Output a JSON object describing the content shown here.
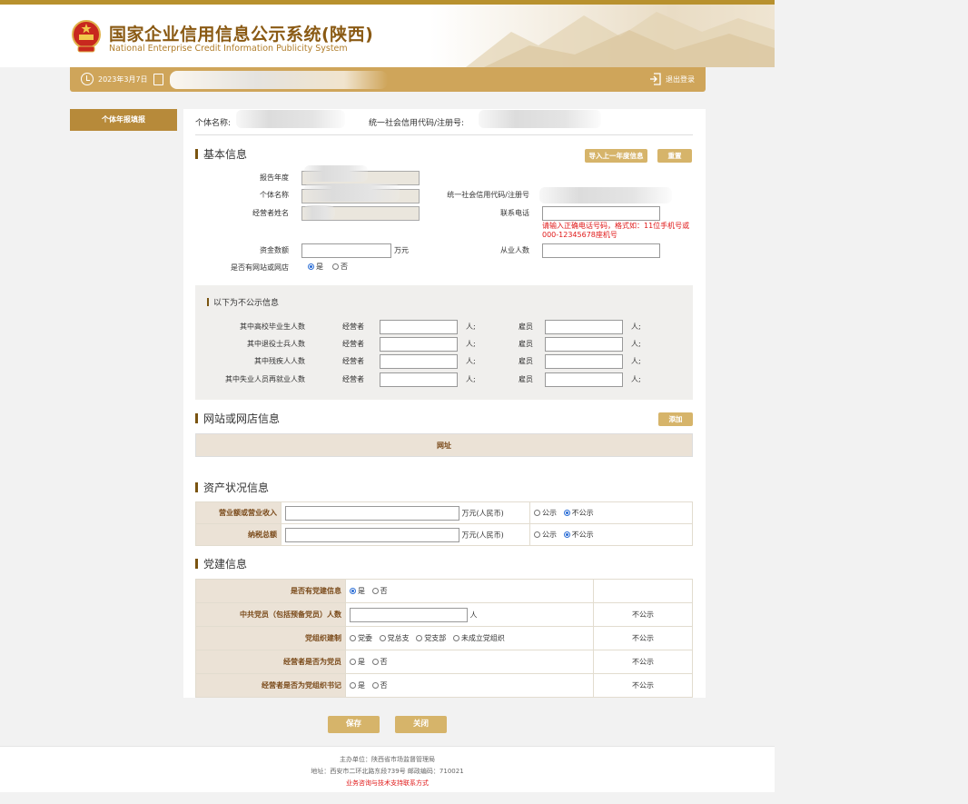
{
  "header": {
    "title_cn": "国家企业信用信息公示系统(陕西)",
    "title_en": "National Enterprise Credit Information Publicity System"
  },
  "navbar": {
    "date": "2023年3月7日",
    "logout": "退出登录"
  },
  "sidebar": {
    "tab_label": "个体年报填报"
  },
  "top_info": {
    "name_label": "个体名称:",
    "code_label": "统一社会信用代码/注册号:"
  },
  "basic": {
    "title": "基本信息",
    "import_button": "导入上一年度信息",
    "reset_button": "重置",
    "report_year_label": "报告年度",
    "name_label": "个体名称",
    "code_label": "统一社会信用代码/注册号",
    "operator_label": "经营者姓名",
    "phone_label": "联系电话",
    "phone_hint": "请输入正确电话号码，格式如：11位手机号或000-12345678座机号",
    "capital_label": "资金数额",
    "capital_unit": "万元",
    "employees_label": "从业人数",
    "website_label": "是否有网站或网店",
    "yes": "是",
    "no": "否"
  },
  "nonpublic": {
    "title": "以下为不公示信息",
    "rows": [
      {
        "label": "其中高校毕业生人数",
        "operator": "经营者",
        "unit": "人;",
        "employee": "雇员",
        "unit2": "人;"
      },
      {
        "label": "其中退役士兵人数",
        "operator": "经营者",
        "unit": "人;",
        "employee": "雇员",
        "unit2": "人;"
      },
      {
        "label": "其中残疾人人数",
        "operator": "经营者",
        "unit": "人;",
        "employee": "雇员",
        "unit2": "人;"
      },
      {
        "label": "其中失业人员再就业人数",
        "operator": "经营者",
        "unit": "人;",
        "employee": "雇员",
        "unit2": "人;"
      }
    ]
  },
  "website": {
    "title": "网站或网店信息",
    "add_button": "添加",
    "col_header": "网址"
  },
  "assets": {
    "title": "资产状况信息",
    "rows": [
      {
        "label": "营业额或营业收入",
        "unit": "万元(人民币)",
        "public": "公示",
        "private": "不公示"
      },
      {
        "label": "纳税总额",
        "unit": "万元(人民币)",
        "public": "公示",
        "private": "不公示"
      }
    ]
  },
  "party": {
    "title": "党建信息",
    "has_party_label": "是否有党建信息",
    "members_label": "中共党员（包括预备党员）人数",
    "members_unit": "人",
    "org_label": "党组织建制",
    "org_options": [
      "党委",
      "党总支",
      "党支部",
      "未成立党组织"
    ],
    "operator_member_label": "经营者是否为党员",
    "operator_secretary_label": "经营者是否为党组织书记",
    "yes": "是",
    "no": "否",
    "not_public": "不公示"
  },
  "actions": {
    "save": "保存",
    "close": "关闭"
  },
  "footer": {
    "line1": "主办单位：陕西省市场监督管理局",
    "line2": "地址：西安市二环北路东段739号   邮政编码：710021",
    "line3": "业务咨询与技术支持联系方式"
  }
}
